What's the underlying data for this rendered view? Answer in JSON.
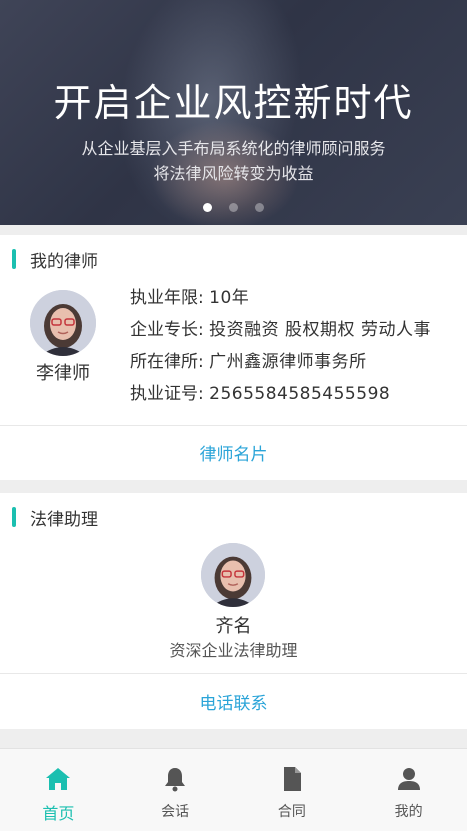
{
  "banner": {
    "title": "开启企业风控新时代",
    "subtitle_line1": "从企业基层入手布局系统化的律师顾问服务",
    "subtitle_line2": "将法律风险转变为收益",
    "slide_count": 3,
    "active_slide": 1
  },
  "my_lawyer": {
    "section_title": "我的律师",
    "name": "李律师",
    "fields": [
      {
        "label": "执业年限:",
        "value": "10年"
      },
      {
        "label": "企业专长:",
        "value": "投资融资 股权期权 劳动人事"
      },
      {
        "label": "所在律所:",
        "value": "广州鑫源律师事务所"
      },
      {
        "label": "执业证号:",
        "value": "2565584585455598"
      }
    ],
    "card_link": "律师名片"
  },
  "legal_assistant": {
    "section_title": "法律助理",
    "name": "齐名",
    "role": "资深企业法律助理",
    "contact_link": "电话联系"
  },
  "tabbar": {
    "items": [
      {
        "label": "首页",
        "icon": "home-icon",
        "active": true
      },
      {
        "label": "会话",
        "icon": "bell-icon",
        "active": false
      },
      {
        "label": "合同",
        "icon": "document-icon",
        "active": false
      },
      {
        "label": "我的",
        "icon": "person-icon",
        "active": false
      }
    ]
  },
  "colors": {
    "accent": "#1bbfb0",
    "link": "#2aa4d8",
    "banner_bg": "#353a4c"
  }
}
